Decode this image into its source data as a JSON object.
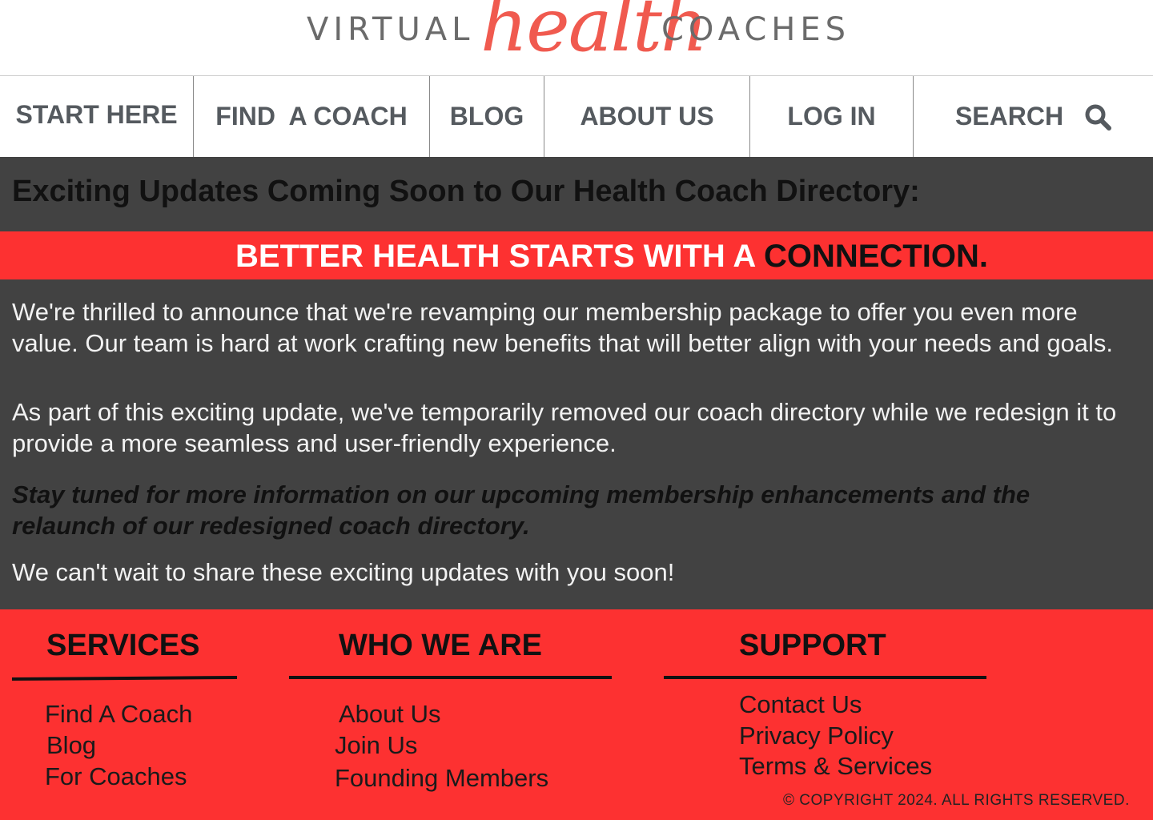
{
  "logo": {
    "left_word": "VIRTUAL",
    "script_word": "health",
    "right_word": "COACHES"
  },
  "nav": {
    "items": [
      {
        "label": "START HERE"
      },
      {
        "label": "FIND  A COACH"
      },
      {
        "label": "BLOG"
      },
      {
        "label": "ABOUT US"
      },
      {
        "label": "LOG IN"
      },
      {
        "label": "SEARCH"
      }
    ],
    "search_icon": "search-icon"
  },
  "main": {
    "headline": "Exciting Updates Coming Soon to Our Health Coach Directory:",
    "banner_white": "BETTER HEALTH STARTS WITH A ",
    "banner_dark": "CONNECTION.",
    "paragraph1": "We're thrilled to announce that we're revamping our membership package to offer you even more value. Our team is hard at work crafting new benefits that will better align with your needs and goals.",
    "paragraph2": "As part of this exciting update, we've temporarily removed our coach directory while we redesign it to provide a more seamless and user-friendly experience.",
    "paragraph3": "Stay tuned for more information on our upcoming membership enhancements and the relaunch of our redesigned coach directory.",
    "paragraph4": "We can't wait to share these exciting updates with you soon!"
  },
  "footer": {
    "services": {
      "heading": "SERVICES",
      "links": [
        "Find A Coach",
        "Blog",
        "For Coaches"
      ]
    },
    "who_we_are": {
      "heading": "WHO WE ARE",
      "links": [
        "About Us",
        "Join Us",
        "Founding Members"
      ]
    },
    "support": {
      "heading": "SUPPORT",
      "links": [
        "Contact Us",
        "Privacy Policy",
        "Terms & Services"
      ]
    },
    "copyright": "© COPYRIGHT 2024. ALL RIGHTS RESERVED."
  },
  "colors": {
    "accent_red": "#fd3131",
    "dark_panel": "#424242",
    "logo_script": "#f05a4f"
  }
}
